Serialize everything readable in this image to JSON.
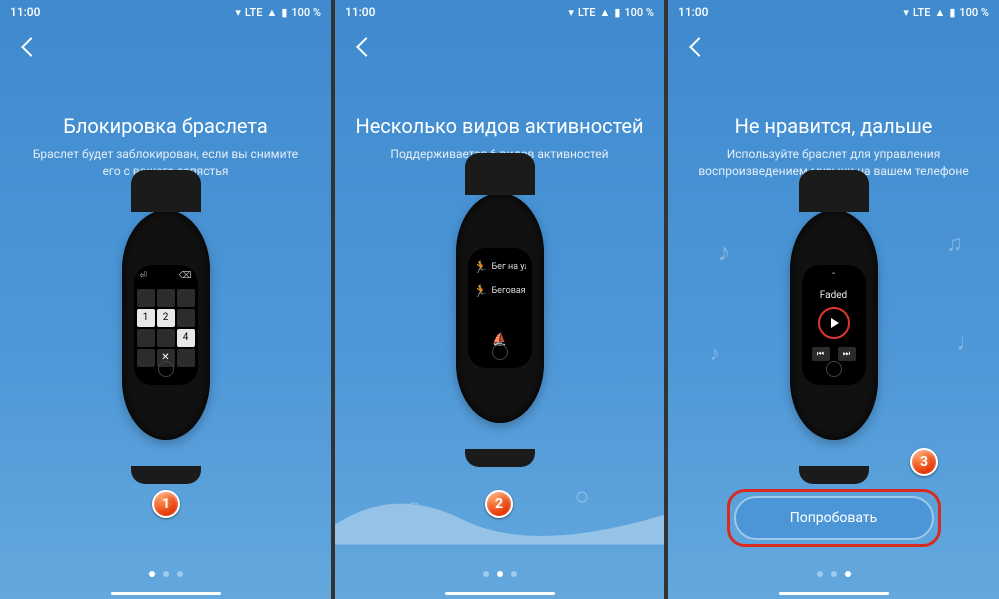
{
  "status": {
    "time": "11:00",
    "net": "LTE",
    "signal_icon": "▲",
    "battery_text": "100 %"
  },
  "screens": [
    {
      "title": "Блокировка браслета",
      "subtitle": "Браслет будет заблокирован, если вы снимите его с вашего запястья",
      "band": {
        "type": "keypad",
        "keys": [
          "",
          "",
          "",
          "1",
          "2",
          "",
          "",
          "",
          "4",
          "",
          "✕",
          ""
        ],
        "hl": [
          3,
          4,
          8
        ],
        "top_left": "⏎",
        "top_right": "⌫"
      },
      "page_index": 0
    },
    {
      "title": "Несколько видов активностей",
      "subtitle": "Поддерживается 6 видов активностей",
      "band": {
        "type": "activities",
        "items": [
          "Бег на ули",
          "Беговая до"
        ]
      },
      "page_index": 1
    },
    {
      "title": "Не нравится, дальше",
      "subtitle": "Используйте браслет для управления воспроизведением музыки на вашем телефоне",
      "band": {
        "type": "music",
        "song": "Faded"
      },
      "page_index": 2,
      "cta": "Попробовать"
    }
  ],
  "badges": [
    "1",
    "2",
    "3"
  ]
}
